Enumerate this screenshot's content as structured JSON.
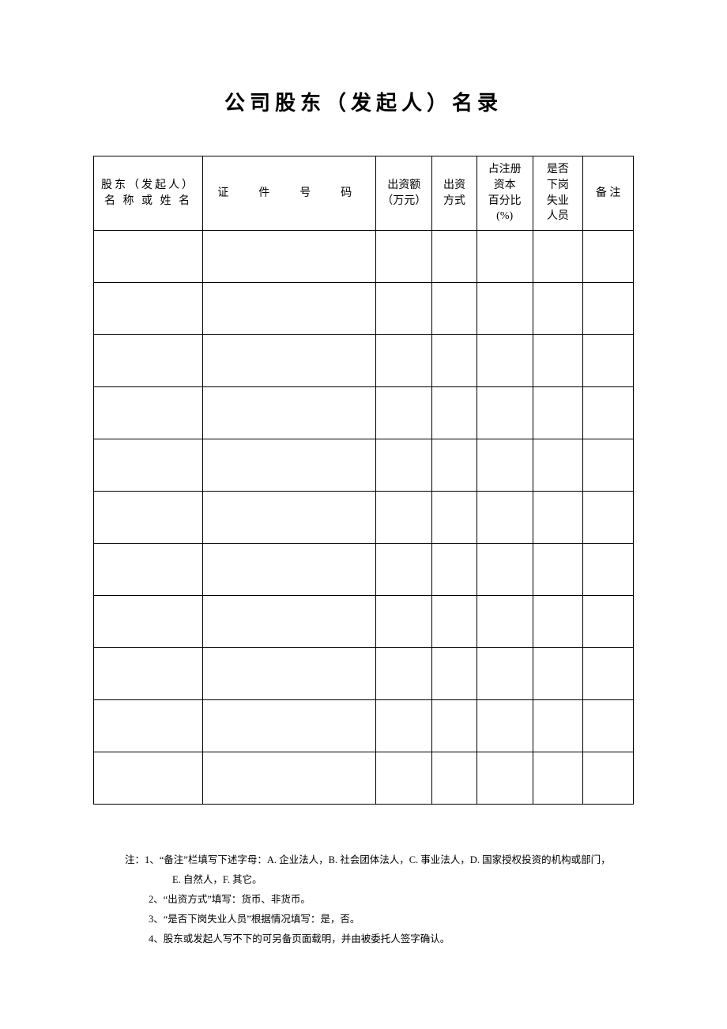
{
  "title": "公司股东（发起人）名录",
  "headers": {
    "col0": "股东（发起人）\n名 称 或 姓 名",
    "col1": "证　件　号　码",
    "col2": "出资额\n（万元）",
    "col3": "出资\n方式",
    "col4": "占注册\n资本\n百分比\n(%)",
    "col5": "是否\n下岗\n失业\n人员",
    "col6": "备 注"
  },
  "rows": [
    {
      "c0": "",
      "c1": "",
      "c2": "",
      "c3": "",
      "c4": "",
      "c5": "",
      "c6": ""
    },
    {
      "c0": "",
      "c1": "",
      "c2": "",
      "c3": "",
      "c4": "",
      "c5": "",
      "c6": ""
    },
    {
      "c0": "",
      "c1": "",
      "c2": "",
      "c3": "",
      "c4": "",
      "c5": "",
      "c6": ""
    },
    {
      "c0": "",
      "c1": "",
      "c2": "",
      "c3": "",
      "c4": "",
      "c5": "",
      "c6": ""
    },
    {
      "c0": "",
      "c1": "",
      "c2": "",
      "c3": "",
      "c4": "",
      "c5": "",
      "c6": ""
    },
    {
      "c0": "",
      "c1": "",
      "c2": "",
      "c3": "",
      "c4": "",
      "c5": "",
      "c6": ""
    },
    {
      "c0": "",
      "c1": "",
      "c2": "",
      "c3": "",
      "c4": "",
      "c5": "",
      "c6": ""
    },
    {
      "c0": "",
      "c1": "",
      "c2": "",
      "c3": "",
      "c4": "",
      "c5": "",
      "c6": ""
    },
    {
      "c0": "",
      "c1": "",
      "c2": "",
      "c3": "",
      "c4": "",
      "c5": "",
      "c6": ""
    },
    {
      "c0": "",
      "c1": "",
      "c2": "",
      "c3": "",
      "c4": "",
      "c5": "",
      "c6": ""
    },
    {
      "c0": "",
      "c1": "",
      "c2": "",
      "c3": "",
      "c4": "",
      "c5": "",
      "c6": ""
    }
  ],
  "notes": {
    "n1": "注：1、“备注”栏填写下述字母：A. 企业法人，B. 社会团体法人，C. 事业法人，D. 国家授权投资的机构或部门，",
    "n1b": "E. 自然人，F. 其它。",
    "n2": "2、“出资方式”填写：货币、非货币。",
    "n3": "3、“是否下岗失业人员”根据情况填写：是，否。",
    "n4": "4、股东或发起人写不下的可另备页面载明，并由被委托人签字确认。"
  }
}
